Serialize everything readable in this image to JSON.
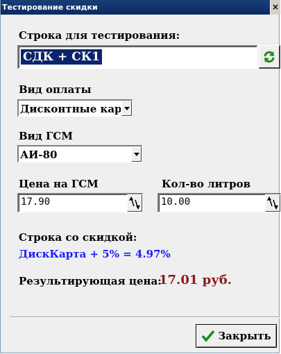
{
  "window": {
    "title": "Тестирование скидки",
    "close_glyph": "×"
  },
  "test_string": {
    "label": "Строка для тестирования:",
    "value": "СДК + СК1",
    "refresh_icon": "refresh-icon"
  },
  "payment": {
    "label": "Вид оплаты",
    "selected": "Дисконтные карты"
  },
  "fuel": {
    "label": "Вид ГСМ",
    "selected": "АИ-80"
  },
  "price": {
    "label": "Цена на ГСМ",
    "value": "17.90"
  },
  "liters": {
    "label": "Кол-во литров",
    "value": "10.00"
  },
  "discount": {
    "label": "Строка со скидкой:",
    "value": "ДискКарта + 5%  = 4.97%",
    "color": "#1b1bff"
  },
  "result": {
    "label": "Результирующая цена:",
    "value": "17.01 руб.",
    "color": "#8b1a1a"
  },
  "close_button": {
    "label": "Закрыть",
    "icon": "checkmark-icon",
    "icon_color": "#1a8a1a"
  }
}
